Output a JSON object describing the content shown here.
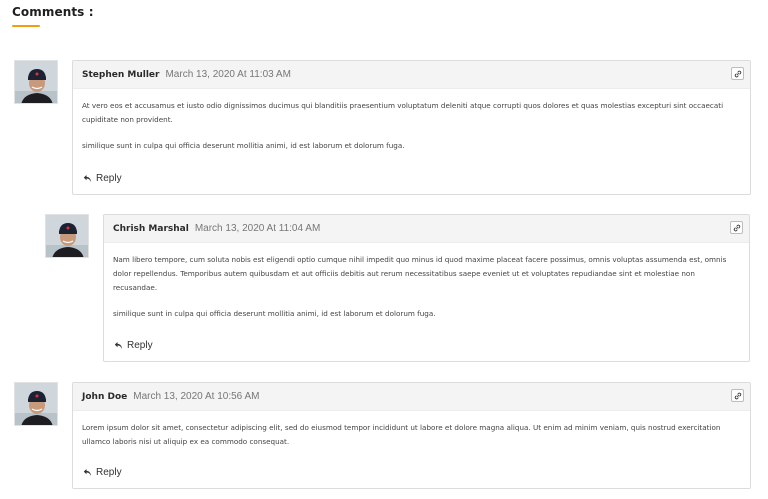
{
  "section": {
    "title": "Comments :",
    "accent_color": "#f39c12"
  },
  "comments": [
    {
      "author": "Stephen Muller",
      "date": "March 13, 2020 At 11:03 AM",
      "paragraphs": [
        "At vero eos et accusamus et iusto odio dignissimos ducimus qui blanditiis praesentium voluptatum deleniti atque corrupti quos dolores et quas molestias excepturi sint occaecati cupiditate non provident.",
        "similique sunt in culpa qui officia deserunt mollitia animi, id est laborum et dolorum fuga."
      ],
      "reply_label": "Reply",
      "link_icon": "link-icon"
    },
    {
      "author": "Chrish Marshal",
      "date": "March 13, 2020 At 11:04 AM",
      "paragraphs": [
        "Nam libero tempore, cum soluta nobis est eligendi optio cumque nihil impedit quo minus id quod maxime placeat facere possimus, omnis voluptas assumenda est, omnis dolor repellendus. Temporibus autem quibusdam et aut officiis debitis aut rerum necessitatibus saepe eveniet ut et voluptates repudiandae sint et molestiae non recusandae.",
        "similique sunt in culpa qui officia deserunt mollitia animi, id est laborum et dolorum fuga."
      ],
      "reply_label": "Reply",
      "link_icon": "link-icon"
    },
    {
      "author": "John Doe",
      "date": "March 13, 2020 At 10:56 AM",
      "paragraphs": [
        "Lorem ipsum dolor sit amet, consectetur adipiscing elit, sed do eiusmod tempor incididunt ut labore et dolore magna aliqua. Ut enim ad minim veniam, quis nostrud exercitation ullamco laboris nisi ut aliquip ex ea commodo consequat."
      ],
      "reply_label": "Reply",
      "link_icon": "link-icon"
    }
  ]
}
